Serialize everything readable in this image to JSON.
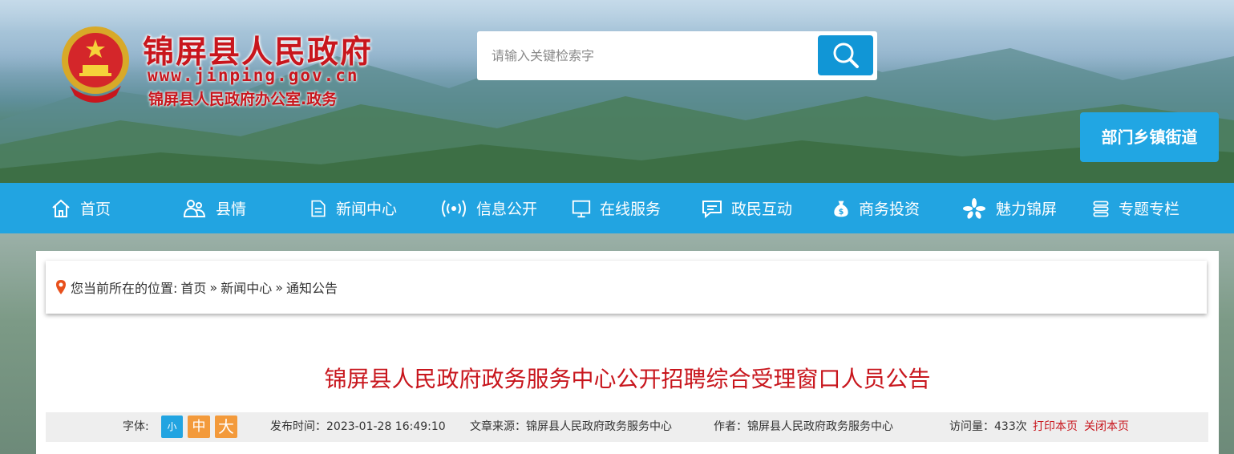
{
  "header": {
    "site_title": "锦屏县人民政府",
    "site_url": "www.jinping.gov.cn",
    "site_subtitle": "锦屏县人民政府办公室.政务",
    "search": {
      "placeholder": "请输入关键检索字"
    },
    "dept_button": "部门乡镇街道"
  },
  "nav": {
    "items": [
      {
        "label": "首页",
        "icon": "home-icon"
      },
      {
        "label": "县情",
        "icon": "people-icon"
      },
      {
        "label": "新闻中心",
        "icon": "document-icon"
      },
      {
        "label": "信息公开",
        "icon": "broadcast-icon"
      },
      {
        "label": "在线服务",
        "icon": "monitor-icon"
      },
      {
        "label": "政民互动",
        "icon": "chat-icon"
      },
      {
        "label": "商务投资",
        "icon": "money-bag-icon"
      },
      {
        "label": "魅力锦屏",
        "icon": "flower-icon"
      },
      {
        "label": "专题专栏",
        "icon": "stack-icon"
      }
    ]
  },
  "breadcrumb": {
    "prefix": "您当前所在的位置:",
    "path": [
      "首页",
      "新闻中心",
      "通知公告"
    ],
    "separator": "»"
  },
  "article": {
    "title": "锦屏县人民政府政务服务中心公开招聘综合受理窗口人员公告",
    "meta": {
      "font_label": "字体:",
      "font_sizes": [
        "小",
        "中",
        "大"
      ],
      "publish_time": "发布时间：2023-01-28 16:49:10",
      "source": "文章来源：锦屏县人民政府政务服务中心",
      "author": "作者：锦屏县人民政府政务服务中心",
      "views": "访问量：433次",
      "print": "打印本页",
      "close": "关闭本页"
    }
  },
  "colors": {
    "brand_red": "#c8161d",
    "nav_blue": "#22a4e1",
    "search_blue": "#1196d6",
    "font_small_bg": "#22a4e1",
    "font_mid_bg": "#f39a3b",
    "font_large_bg": "#f39a3b"
  }
}
